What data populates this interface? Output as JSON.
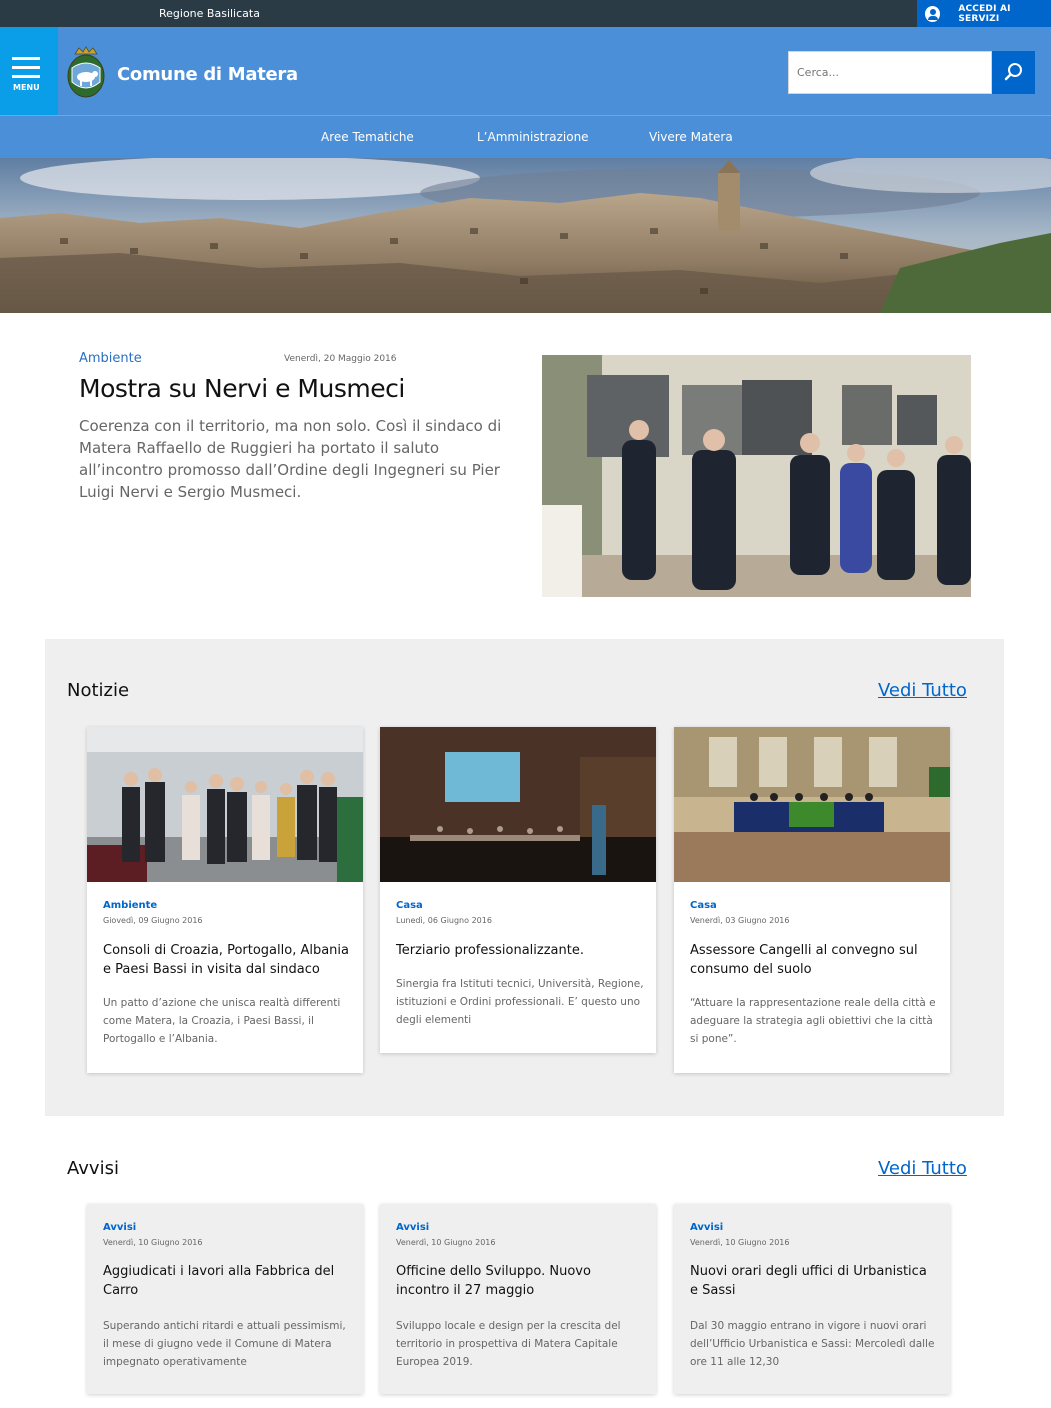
{
  "topbar": {
    "region": "Regione Basilicata",
    "login_label": "ACCEDI AI SERVIZI"
  },
  "header": {
    "menu_label": "MENU",
    "title": "Comune di Matera",
    "search_placeholder": "Cerca..."
  },
  "nav": {
    "items": [
      {
        "label": "Aree Tematiche"
      },
      {
        "label": "L’Amministrazione"
      },
      {
        "label": "Vivere Matera"
      }
    ]
  },
  "featured": {
    "category": "Ambiente",
    "date": "Venerdì, 20 Maggio 2016",
    "title": "Mostra su Nervi e Musmeci",
    "text": "Coerenza con il territorio, ma non solo. Così il sindaco di Matera Raffaello de Ruggieri ha portato il saluto all’incontro promosso dall’Ordine degli Ingegneri su Pier Luigi Nervi e Sergio Musmeci."
  },
  "notizie": {
    "title": "Notizie",
    "see_all": "Vedi Tutto",
    "items": [
      {
        "category": "Ambiente",
        "date": "Giovedì, 09 Giugno 2016",
        "title": "Consoli di Croazia, Portogallo, Albania e Paesi Bassi in visita dal sindaco",
        "text": "Un patto d’azione che unisca realtà differenti come Matera, la Croazia, i Paesi Bassi, il Portogallo e l’Albania."
      },
      {
        "category": "Casa",
        "date": "Lunedì, 06 Giugno 2016",
        "title": "Terziario professionalizzante.",
        "text": "Sinergia fra Istituti tecnici, Università, Regione, istituzioni e Ordini professionali. E’ questo uno degli elementi"
      },
      {
        "category": "Casa",
        "date": "Venerdì, 03 Giugno 2016",
        "title": "Assessore Cangelli al convegno sul consumo del suolo",
        "text": "“Attuare la rappresentazione reale della città e adeguare la strategia agli obiettivi che la città si pone”."
      }
    ]
  },
  "avvisi": {
    "title": "Avvisi",
    "see_all": "Vedi Tutto",
    "items": [
      {
        "category": "Avvisi",
        "date": "Venerdì, 10 Giugno 2016",
        "title": "Aggiudicati i lavori alla Fabbrica del Carro",
        "text": "Superando antichi ritardi e attuali pessimismi, il mese di giugno vede il Comune di Matera impegnato operativamente"
      },
      {
        "category": "Avvisi",
        "date": "Venerdì, 10 Giugno 2016",
        "title": "Officine dello Sviluppo. Nuovo incontro il 27 maggio",
        "text": "Sviluppo locale e design per la crescita del territorio in prospettiva di Matera Capitale Europea 2019."
      },
      {
        "category": "Avvisi",
        "date": "Venerdì, 10 Giugno 2016",
        "title": "Nuovi orari degli uffici di Urbanistica e Sassi",
        "text": "Dal 30 maggio entrano in vigore i nuovi orari dell’Ufficio Urbanistica e Sassi: Mercoledì dalle ore 11 alle 12,30"
      }
    ]
  },
  "colors": {
    "header": "#4a8fd8",
    "menu": "#0b9ee8",
    "accent": "#0066cc",
    "topbar": "#2b3b46"
  },
  "icons": {
    "user": "user-circle-icon",
    "search": "search-icon",
    "menu": "hamburger-icon",
    "logo": "coat-of-arms"
  }
}
